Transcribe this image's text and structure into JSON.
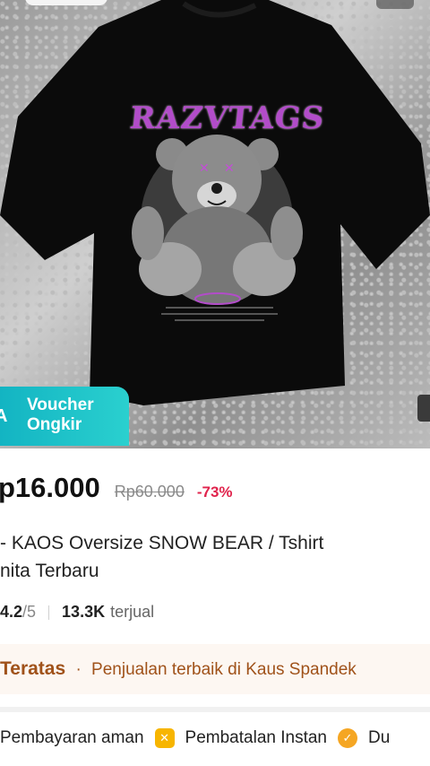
{
  "hero": {
    "graphic_text": "RAZVTAGS",
    "voucher": {
      "prefix": "A",
      "line1": "Voucher",
      "line2": "Ongkir"
    }
  },
  "product": {
    "price": "p16.000",
    "original_price": "Rp60.000",
    "discount": "-73%",
    "title_line1": "- KAOS Oversize SNOW BEAR / Tshirt",
    "title_line2": "nita Terbaru",
    "rating": "4.2",
    "rating_max": "/5",
    "sold_count": "13.3K",
    "sold_label": "terjual"
  },
  "ranking": {
    "label": "Teratas",
    "separator": "·",
    "description": "Penjualan terbaik di Kaus Spandek"
  },
  "benefits": [
    {
      "label": "Pembayaran aman"
    },
    {
      "label": "Pembatalan Instan"
    },
    {
      "label": "Du"
    }
  ],
  "colors": {
    "discount": "#e0234c",
    "voucher": "#1bbfc8",
    "ranking_text": "#a0521a"
  }
}
